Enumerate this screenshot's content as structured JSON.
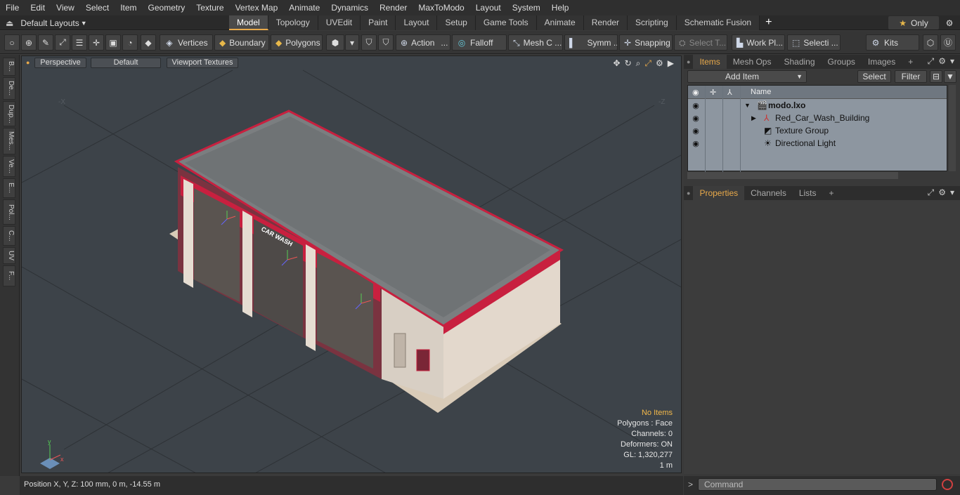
{
  "menu": [
    "File",
    "Edit",
    "View",
    "Select",
    "Item",
    "Geometry",
    "Texture",
    "Vertex Map",
    "Animate",
    "Dynamics",
    "Render",
    "MaxToModo",
    "Layout",
    "System",
    "Help"
  ],
  "layout_dropdown": "Default Layouts",
  "tabs": [
    "Model",
    "Topology",
    "UVEdit",
    "Paint",
    "Layout",
    "Setup",
    "Game Tools",
    "Animate",
    "Render",
    "Scripting",
    "Schematic Fusion"
  ],
  "active_tab": "Model",
  "only_label": "Only",
  "toolbar": {
    "vertices": "Vertices",
    "boundary": "Boundary",
    "polygons": "Polygons",
    "action": "Action",
    "falloff": "Falloff",
    "mesh": "Mesh C ...",
    "symm": "Symm ...",
    "snapping": "Snapping",
    "select_t": "Select T...",
    "work_pl": "Work Pl...",
    "selecti": "Selecti ...",
    "kits": "Kits"
  },
  "left_tabs": [
    "B...",
    "De...",
    "Dup...",
    "Mes...",
    "Ve...",
    "E...",
    "Pol...",
    "C...",
    "UV",
    "F..."
  ],
  "viewport": {
    "view": "Perspective",
    "shading": "Default",
    "textures": "Viewport Textures",
    "sign": "CAR WASH",
    "info": {
      "no_items": "No Items",
      "polygons": "Polygons : Face",
      "channels": "Channels: 0",
      "deformers": "Deformers: ON",
      "gl": "GL: 1,320,277",
      "scale": "1 m"
    }
  },
  "status": "Position X, Y, Z:   100 mm, 0 m, -14.55 m",
  "items_panel": {
    "tabs": [
      "Items",
      "Mesh Ops",
      "Shading",
      "Groups",
      "Images"
    ],
    "add_item": "Add Item",
    "select": "Select",
    "filter": "Filter",
    "column_name": "Name",
    "rows": [
      {
        "name": "modo.lxo",
        "bold": true
      },
      {
        "name": "Red_Car_Wash_Building",
        "bold": false
      },
      {
        "name": "Texture Group",
        "bold": false
      },
      {
        "name": "Directional Light",
        "bold": false
      }
    ]
  },
  "props_panel": {
    "tabs": [
      "Properties",
      "Channels",
      "Lists"
    ]
  },
  "command_placeholder": "Command",
  "colors": {
    "accent": "#e8a94a",
    "building_red": "#d0143c"
  }
}
